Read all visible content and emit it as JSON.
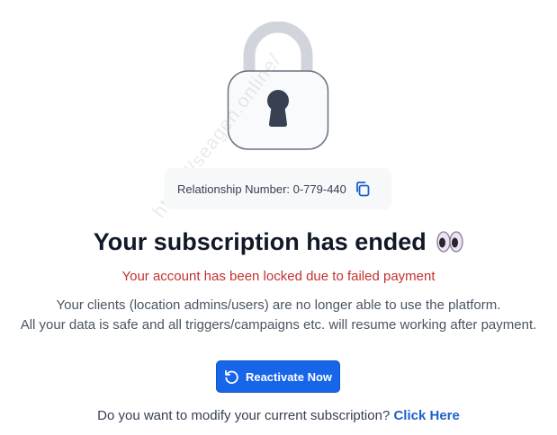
{
  "lock": {
    "icon": "padlock-icon"
  },
  "watermark": {
    "text": "https://seagen.online/"
  },
  "relationship": {
    "label": "Relationship Number: 0-779-440",
    "copy_icon": "copy-icon"
  },
  "title": {
    "text": "Your subscription has ended",
    "emoji_icon": "eyes-icon"
  },
  "error": {
    "text": "Your account has been locked due to failed payment"
  },
  "description": {
    "line1": "Your clients (location admins/users) are no longer able to use the platform.",
    "line2": "All your data is safe and all triggers/campaigns etc. will resume working after payment."
  },
  "button": {
    "label": "Reactivate Now",
    "icon": "refresh-icon"
  },
  "footer": {
    "question": "Do you want to modify your current subscription?",
    "link": "Click Here"
  },
  "colors": {
    "accent": "#1765e8",
    "error": "#c53030",
    "link": "#1d5fcf"
  }
}
